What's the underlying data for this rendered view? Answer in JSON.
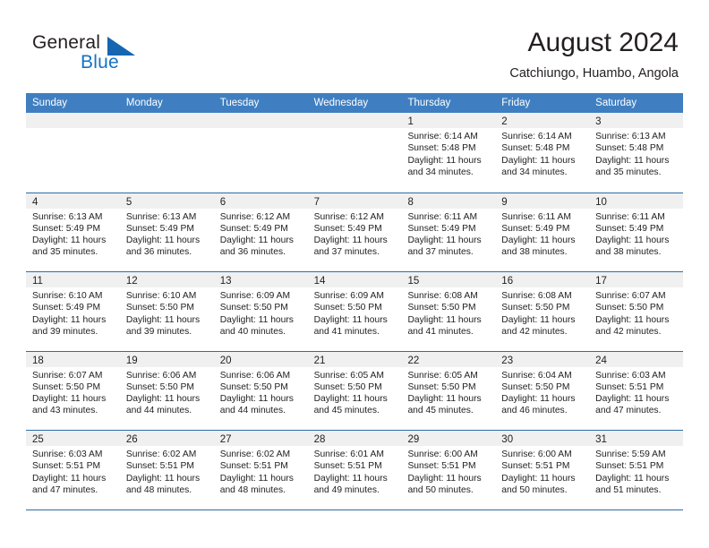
{
  "brand": {
    "word1": "General",
    "word2": "Blue",
    "triangle_color": "#1565b0",
    "blue_text_color": "#1573c4"
  },
  "header": {
    "title": "August 2024",
    "subtitle": "Catchiungo, Huambo, Angola"
  },
  "theme": {
    "header_blue": "#3f7fc1",
    "rule_blue": "#2e6da8",
    "day_band_gray": "#f0f0f0"
  },
  "weekday_headers": [
    "Sunday",
    "Monday",
    "Tuesday",
    "Wednesday",
    "Thursday",
    "Friday",
    "Saturday"
  ],
  "labels": {
    "sunrise_prefix": "Sunrise:",
    "sunset_prefix": "Sunset:",
    "daylight_prefix": "Daylight:"
  },
  "weeks": [
    [
      {
        "day": "",
        "line1": "",
        "line2": "",
        "line3": "",
        "line4": ""
      },
      {
        "day": "",
        "line1": "",
        "line2": "",
        "line3": "",
        "line4": ""
      },
      {
        "day": "",
        "line1": "",
        "line2": "",
        "line3": "",
        "line4": ""
      },
      {
        "day": "",
        "line1": "",
        "line2": "",
        "line3": "",
        "line4": ""
      },
      {
        "day": "1",
        "line1": "Sunrise: 6:14 AM",
        "line2": "Sunset: 5:48 PM",
        "line3": "Daylight: 11 hours",
        "line4": "and 34 minutes."
      },
      {
        "day": "2",
        "line1": "Sunrise: 6:14 AM",
        "line2": "Sunset: 5:48 PM",
        "line3": "Daylight: 11 hours",
        "line4": "and 34 minutes."
      },
      {
        "day": "3",
        "line1": "Sunrise: 6:13 AM",
        "line2": "Sunset: 5:48 PM",
        "line3": "Daylight: 11 hours",
        "line4": "and 35 minutes."
      }
    ],
    [
      {
        "day": "4",
        "line1": "Sunrise: 6:13 AM",
        "line2": "Sunset: 5:49 PM",
        "line3": "Daylight: 11 hours",
        "line4": "and 35 minutes."
      },
      {
        "day": "5",
        "line1": "Sunrise: 6:13 AM",
        "line2": "Sunset: 5:49 PM",
        "line3": "Daylight: 11 hours",
        "line4": "and 36 minutes."
      },
      {
        "day": "6",
        "line1": "Sunrise: 6:12 AM",
        "line2": "Sunset: 5:49 PM",
        "line3": "Daylight: 11 hours",
        "line4": "and 36 minutes."
      },
      {
        "day": "7",
        "line1": "Sunrise: 6:12 AM",
        "line2": "Sunset: 5:49 PM",
        "line3": "Daylight: 11 hours",
        "line4": "and 37 minutes."
      },
      {
        "day": "8",
        "line1": "Sunrise: 6:11 AM",
        "line2": "Sunset: 5:49 PM",
        "line3": "Daylight: 11 hours",
        "line4": "and 37 minutes."
      },
      {
        "day": "9",
        "line1": "Sunrise: 6:11 AM",
        "line2": "Sunset: 5:49 PM",
        "line3": "Daylight: 11 hours",
        "line4": "and 38 minutes."
      },
      {
        "day": "10",
        "line1": "Sunrise: 6:11 AM",
        "line2": "Sunset: 5:49 PM",
        "line3": "Daylight: 11 hours",
        "line4": "and 38 minutes."
      }
    ],
    [
      {
        "day": "11",
        "line1": "Sunrise: 6:10 AM",
        "line2": "Sunset: 5:49 PM",
        "line3": "Daylight: 11 hours",
        "line4": "and 39 minutes."
      },
      {
        "day": "12",
        "line1": "Sunrise: 6:10 AM",
        "line2": "Sunset: 5:50 PM",
        "line3": "Daylight: 11 hours",
        "line4": "and 39 minutes."
      },
      {
        "day": "13",
        "line1": "Sunrise: 6:09 AM",
        "line2": "Sunset: 5:50 PM",
        "line3": "Daylight: 11 hours",
        "line4": "and 40 minutes."
      },
      {
        "day": "14",
        "line1": "Sunrise: 6:09 AM",
        "line2": "Sunset: 5:50 PM",
        "line3": "Daylight: 11 hours",
        "line4": "and 41 minutes."
      },
      {
        "day": "15",
        "line1": "Sunrise: 6:08 AM",
        "line2": "Sunset: 5:50 PM",
        "line3": "Daylight: 11 hours",
        "line4": "and 41 minutes."
      },
      {
        "day": "16",
        "line1": "Sunrise: 6:08 AM",
        "line2": "Sunset: 5:50 PM",
        "line3": "Daylight: 11 hours",
        "line4": "and 42 minutes."
      },
      {
        "day": "17",
        "line1": "Sunrise: 6:07 AM",
        "line2": "Sunset: 5:50 PM",
        "line3": "Daylight: 11 hours",
        "line4": "and 42 minutes."
      }
    ],
    [
      {
        "day": "18",
        "line1": "Sunrise: 6:07 AM",
        "line2": "Sunset: 5:50 PM",
        "line3": "Daylight: 11 hours",
        "line4": "and 43 minutes."
      },
      {
        "day": "19",
        "line1": "Sunrise: 6:06 AM",
        "line2": "Sunset: 5:50 PM",
        "line3": "Daylight: 11 hours",
        "line4": "and 44 minutes."
      },
      {
        "day": "20",
        "line1": "Sunrise: 6:06 AM",
        "line2": "Sunset: 5:50 PM",
        "line3": "Daylight: 11 hours",
        "line4": "and 44 minutes."
      },
      {
        "day": "21",
        "line1": "Sunrise: 6:05 AM",
        "line2": "Sunset: 5:50 PM",
        "line3": "Daylight: 11 hours",
        "line4": "and 45 minutes."
      },
      {
        "day": "22",
        "line1": "Sunrise: 6:05 AM",
        "line2": "Sunset: 5:50 PM",
        "line3": "Daylight: 11 hours",
        "line4": "and 45 minutes."
      },
      {
        "day": "23",
        "line1": "Sunrise: 6:04 AM",
        "line2": "Sunset: 5:50 PM",
        "line3": "Daylight: 11 hours",
        "line4": "and 46 minutes."
      },
      {
        "day": "24",
        "line1": "Sunrise: 6:03 AM",
        "line2": "Sunset: 5:51 PM",
        "line3": "Daylight: 11 hours",
        "line4": "and 47 minutes."
      }
    ],
    [
      {
        "day": "25",
        "line1": "Sunrise: 6:03 AM",
        "line2": "Sunset: 5:51 PM",
        "line3": "Daylight: 11 hours",
        "line4": "and 47 minutes."
      },
      {
        "day": "26",
        "line1": "Sunrise: 6:02 AM",
        "line2": "Sunset: 5:51 PM",
        "line3": "Daylight: 11 hours",
        "line4": "and 48 minutes."
      },
      {
        "day": "27",
        "line1": "Sunrise: 6:02 AM",
        "line2": "Sunset: 5:51 PM",
        "line3": "Daylight: 11 hours",
        "line4": "and 48 minutes."
      },
      {
        "day": "28",
        "line1": "Sunrise: 6:01 AM",
        "line2": "Sunset: 5:51 PM",
        "line3": "Daylight: 11 hours",
        "line4": "and 49 minutes."
      },
      {
        "day": "29",
        "line1": "Sunrise: 6:00 AM",
        "line2": "Sunset: 5:51 PM",
        "line3": "Daylight: 11 hours",
        "line4": "and 50 minutes."
      },
      {
        "day": "30",
        "line1": "Sunrise: 6:00 AM",
        "line2": "Sunset: 5:51 PM",
        "line3": "Daylight: 11 hours",
        "line4": "and 50 minutes."
      },
      {
        "day": "31",
        "line1": "Sunrise: 5:59 AM",
        "line2": "Sunset: 5:51 PM",
        "line3": "Daylight: 11 hours",
        "line4": "and 51 minutes."
      }
    ]
  ]
}
